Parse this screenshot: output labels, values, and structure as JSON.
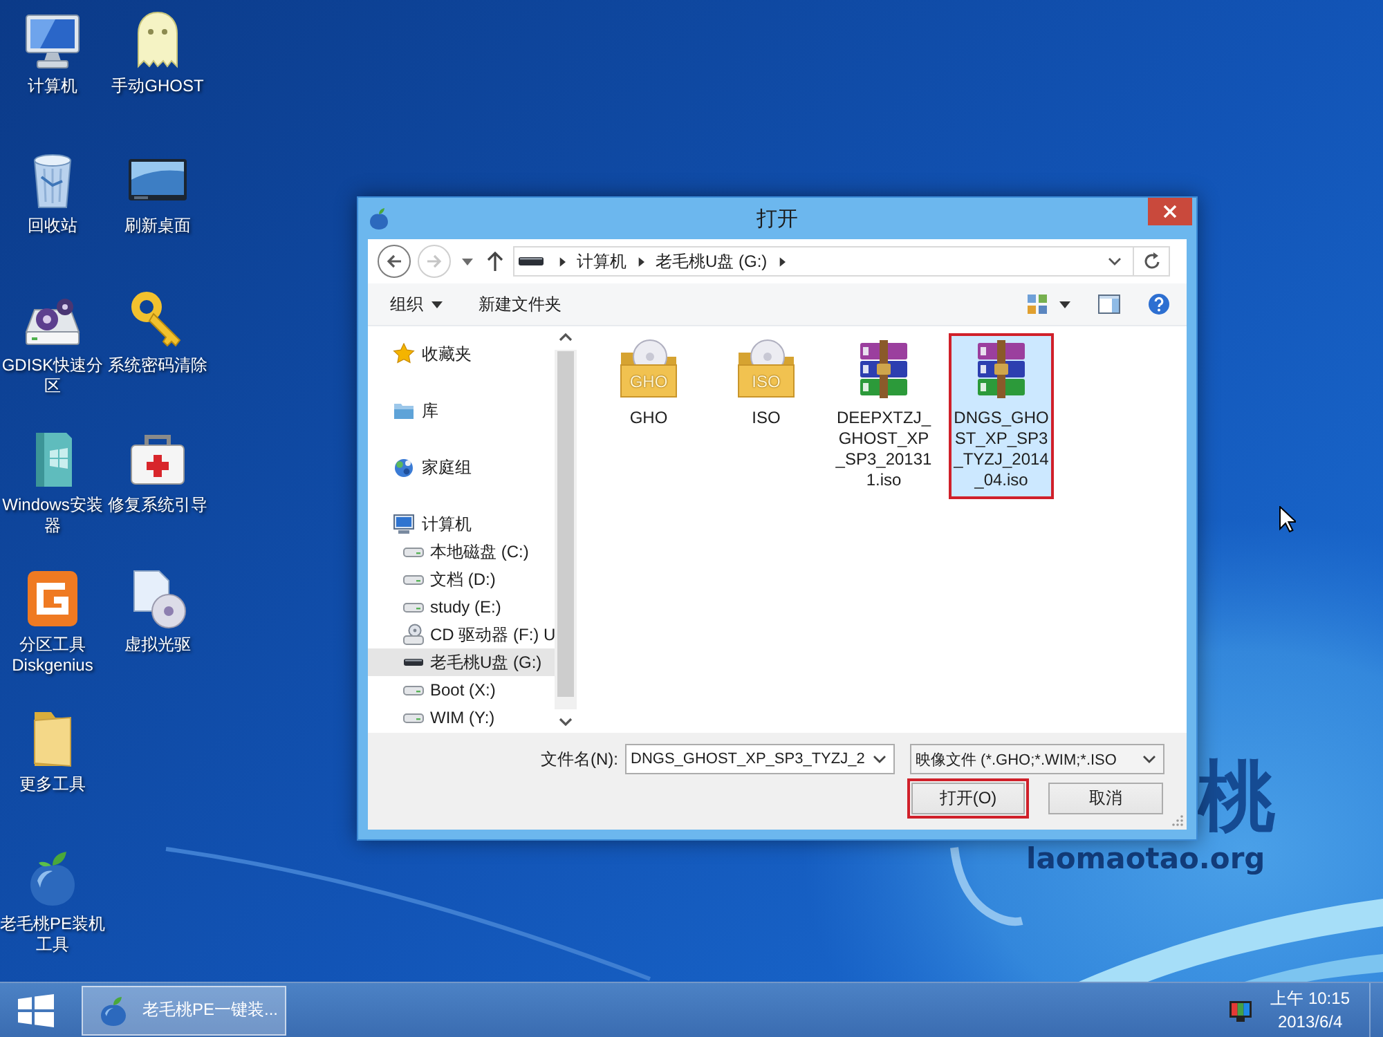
{
  "desktop": {
    "icons": [
      {
        "label": "计算机",
        "kind": "computer"
      },
      {
        "label": "回收站",
        "kind": "recyclebin"
      },
      {
        "label": "GDISK快速分区",
        "kind": "gdisk"
      },
      {
        "label": "Windows安装器",
        "kind": "installer"
      },
      {
        "label": "分区工具Diskgenius",
        "kind": "diskgenius"
      },
      {
        "label": "更多工具",
        "kind": "folder"
      },
      {
        "label": "老毛桃PE装机工具",
        "kind": "peach"
      },
      {
        "label": "手动GHOST",
        "kind": "ghost"
      },
      {
        "label": "刷新桌面",
        "kind": "screen"
      },
      {
        "label": "系统密码清除",
        "kind": "key"
      },
      {
        "label": "修复系统引导",
        "kind": "firstaid"
      },
      {
        "label": "虚拟光驱",
        "kind": "disc"
      }
    ]
  },
  "dialog": {
    "title": "打开",
    "navigation": {
      "back": {
        "disabled": false
      },
      "forward": {
        "disabled": true
      }
    },
    "address": {
      "crumbs": [
        "计算机",
        "老毛桃U盘 (G:)"
      ]
    },
    "toolbar": {
      "organize": "组织",
      "new_folder": "新建文件夹"
    },
    "sidebar": {
      "items": [
        {
          "label": "收藏夹",
          "kind": "favorites",
          "selected": false
        },
        {
          "label": "库",
          "kind": "library",
          "selected": false
        },
        {
          "label": "家庭组",
          "kind": "homegroup",
          "selected": false
        },
        {
          "label": "计算机",
          "kind": "computer",
          "selected": false,
          "children": [
            {
              "label": "本地磁盘 (C:)",
              "kind": "disk",
              "selected": false
            },
            {
              "label": "文档 (D:)",
              "kind": "disk",
              "selected": false
            },
            {
              "label": "study (E:)",
              "kind": "disk",
              "selected": false
            },
            {
              "label": "CD 驱动器 (F:) U",
              "kind": "cd",
              "selected": false
            },
            {
              "label": "老毛桃U盘 (G:)",
              "kind": "usb",
              "selected": true
            },
            {
              "label": "Boot (X:)",
              "kind": "disk",
              "selected": false
            },
            {
              "label": "WIM (Y:)",
              "kind": "disk",
              "selected": false
            }
          ]
        }
      ]
    },
    "files": [
      {
        "name": "GHO",
        "kind": "folder",
        "tag": "GHO",
        "selected": false,
        "highlighted": false
      },
      {
        "name": "ISO",
        "kind": "folder",
        "tag": "ISO",
        "selected": false,
        "highlighted": false
      },
      {
        "name": "DEEPXTZJ_GHOST_XP_SP3_201311.iso",
        "kind": "archive",
        "selected": false,
        "highlighted": false
      },
      {
        "name": "DNGS_GHOST_XP_SP3_TYZJ_2014_04.iso",
        "kind": "archive",
        "selected": true,
        "highlighted": true
      }
    ],
    "footer": {
      "filename_label": "文件名(N):",
      "filename": "DNGS_GHOST_XP_SP3_TYZJ_2",
      "filter": "映像文件 (*.GHO;*.WIM;*.ISO",
      "buttons": [
        {
          "label": "打开(O)",
          "highlighted": true
        },
        {
          "label": "取消",
          "highlighted": false
        }
      ]
    }
  },
  "wallpaper": {
    "logo_text": "桃",
    "url": "laomaotao.org"
  },
  "taskbar": {
    "tasks": [
      {
        "label": "老毛桃PE一键装...",
        "selected": true
      }
    ],
    "clock": {
      "time": "上午 10:15",
      "date": "2013/6/4"
    }
  }
}
